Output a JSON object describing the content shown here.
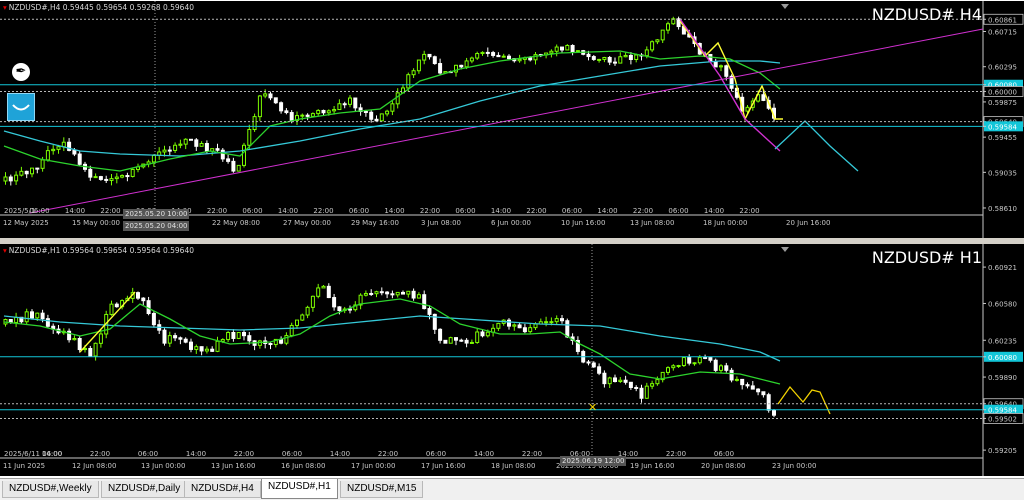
{
  "colors": {
    "bull": "#7CFC00",
    "bear": "#ffffff",
    "ma_fast": "#2dd32d",
    "ma_slow": "#35c9d8",
    "hline": "#12c6d8",
    "trendline": "#d030d0",
    "zigzag_h4": "#ffff33",
    "zigzag_h1": "#ffff33",
    "projection_h4": "#35c9d8",
    "projection_h1": "#f2d200"
  },
  "icons": {
    "pen": "pen-icon",
    "bowl": "bowl-icon",
    "corner": "triangle-marker-icon"
  },
  "top": {
    "header": "NZDUSD#,H4  0.59445 0.59654 0.59268 0.59640",
    "symbol_label": "NZDUSD# H4",
    "price_labels": [
      {
        "text": "0.60861",
        "y": 0.60861,
        "style": "box"
      },
      {
        "text": "0.60715",
        "y": 0.60715,
        "style": "plain"
      },
      {
        "text": "0.60295",
        "y": 0.60295,
        "style": "plain"
      },
      {
        "text": "0.60080",
        "y": 0.6008,
        "style": "cyan"
      },
      {
        "text": "0.60000",
        "y": 0.6,
        "style": "box"
      },
      {
        "text": "0.59875",
        "y": 0.59875,
        "style": "plain"
      },
      {
        "text": "0.59640",
        "y": 0.5964,
        "style": "box"
      },
      {
        "text": "0.59584",
        "y": 0.59584,
        "style": "cyan"
      },
      {
        "text": "0.59455",
        "y": 0.59455,
        "style": "plain"
      },
      {
        "text": "0.59035",
        "y": 0.59035,
        "style": "plain"
      },
      {
        "text": "0.58610",
        "y": 0.5861,
        "style": "plain"
      }
    ],
    "time_labels": [
      "12 May 2025",
      "15 May 00:00",
      "22 May 08:00",
      "27 May 00:00",
      "29 May 16:00",
      "3 Jun 08:00",
      "6 Jun 00:00",
      "10 Jun 16:00",
      "13 Jun 08:00",
      "18 Jun 00:00",
      "20 Jun 16:00"
    ],
    "hour_labels": [
      "2025/5/1",
      "06:00",
      "14:00",
      "22:00",
      "06:00",
      "14:00",
      "22:00",
      "06:00",
      "14:00",
      "22:00",
      "06:00",
      "14:00",
      "22:00",
      "06:00",
      "14:00",
      "22:00",
      "06:00",
      "14:00",
      "22:00",
      "06:00",
      "14:00",
      "22:00"
    ],
    "crosshair_date": "2025.05.20 10:00",
    "crosshair_time": "2025.05.20 04:00"
  },
  "bottom": {
    "header": "NZDUSD#,H1  0.59564 0.59654 0.59564 0.59640",
    "symbol_label": "NZDUSD# H1",
    "price_labels": [
      {
        "text": "0.60921",
        "y": 0.60921,
        "style": "plain"
      },
      {
        "text": "0.60580",
        "y": 0.6058,
        "style": "plain"
      },
      {
        "text": "0.60235",
        "y": 0.60235,
        "style": "plain"
      },
      {
        "text": "0.60080",
        "y": 0.6008,
        "style": "cyan"
      },
      {
        "text": "0.59890",
        "y": 0.5989,
        "style": "plain"
      },
      {
        "text": "0.59640",
        "y": 0.5964,
        "style": "box"
      },
      {
        "text": "0.59584",
        "y": 0.59584,
        "style": "cyan"
      },
      {
        "text": "0.59502",
        "y": 0.59502,
        "style": "box"
      },
      {
        "text": "0.59205",
        "y": 0.59205,
        "style": "plain"
      }
    ],
    "time_labels": [
      "11 Jun 2025",
      "12 Jun 08:00",
      "13 Jun 00:00",
      "13 Jun 16:00",
      "16 Jun 08:00",
      "17 Jun 00:00",
      "17 Jun 16:00",
      "18 Jun 08:00",
      "2025.06.19 06:00",
      "19 Jun 16:00",
      "20 Jun 08:00",
      "23 Jun 00:00"
    ],
    "hour_labels": [
      "2025/6/11 06:00",
      "14:00",
      "22:00",
      "06:00",
      "14:00",
      "22:00",
      "06:00",
      "14:00",
      "22:00",
      "06:00",
      "14:00",
      "22:00",
      "06:00",
      "14:00",
      "22:00",
      "06:00"
    ],
    "crosshair_date": "2025.06.19 12:00"
  },
  "tabs": [
    {
      "label": "NZDUSD#,Weekly",
      "active": false
    },
    {
      "label": "NZDUSD#,Daily",
      "active": false
    },
    {
      "label": "NZDUSD#,H4",
      "active": false
    },
    {
      "label": "NZDUSD#,H1",
      "active": true
    },
    {
      "label": "NZDUSD#,M15",
      "active": false
    }
  ]
}
